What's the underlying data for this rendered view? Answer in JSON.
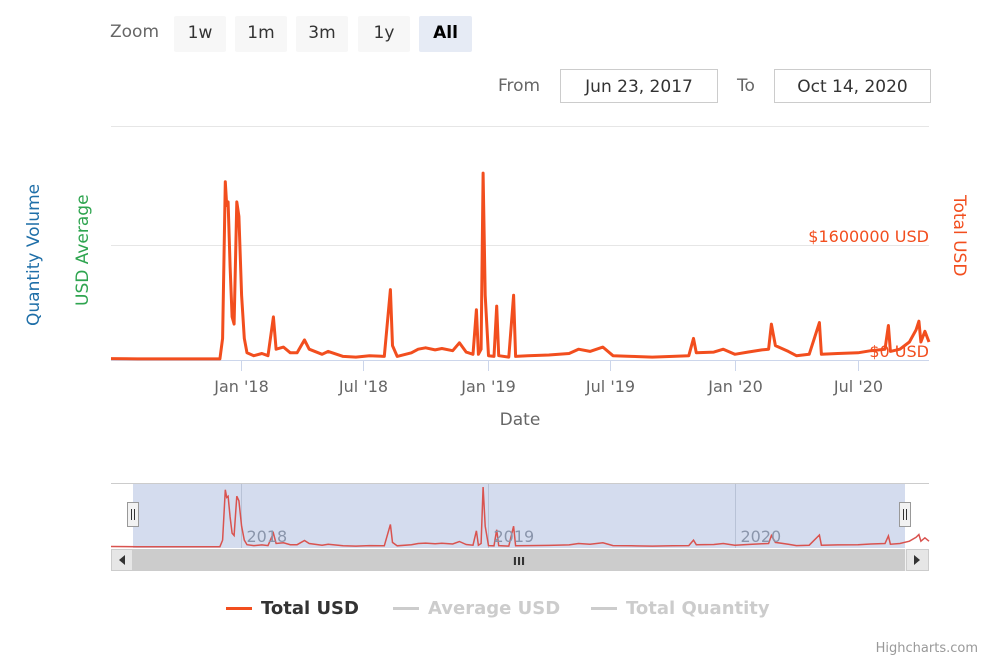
{
  "range_selector": {
    "zoom_label": "Zoom",
    "buttons": [
      {
        "label": "1w",
        "active": false
      },
      {
        "label": "1m",
        "active": false
      },
      {
        "label": "3m",
        "active": false
      },
      {
        "label": "1y",
        "active": false
      },
      {
        "label": "All",
        "active": true
      }
    ],
    "from_label": "From",
    "from_value": "Jun 23, 2017",
    "to_label": "To",
    "to_value": "Oct 14, 2020"
  },
  "colors": {
    "total_usd": "#f24e1e",
    "quantity_axis": "#1f6fa8",
    "average_axis": "#2ea44f",
    "navigator_line": "#d9534f",
    "navigator_mask": "#ccd6eb",
    "legend_hidden": "#cccccc"
  },
  "chart_data": {
    "type": "line",
    "title": "",
    "xlabel": "Date",
    "y_axes": [
      {
        "title": "Quantity Volume",
        "side": "left"
      },
      {
        "title": "USD Average",
        "side": "left"
      },
      {
        "title": "Total USD",
        "side": "right",
        "tick_labels": [
          "$0 USD",
          "$1600000 USD"
        ],
        "ticks": [
          0,
          1600000
        ]
      }
    ],
    "x_range": [
      "2017-06-23",
      "2020-10-14"
    ],
    "ylim": [
      0,
      3000000
    ],
    "x_tick_labels": [
      "Jan '18",
      "Jul '18",
      "Jan '19",
      "Jul '19",
      "Jan '20",
      "Jul '20"
    ],
    "x_ticks": [
      "2018-01-01",
      "2018-07-01",
      "2019-01-01",
      "2019-07-01",
      "2020-01-01",
      "2020-07-01"
    ],
    "grid": true,
    "legend_position": "bottom",
    "series": [
      {
        "name": "Total USD",
        "visible": true,
        "points": [
          [
            "2017-06-23",
            20000
          ],
          [
            "2017-08-01",
            15000
          ],
          [
            "2017-10-01",
            15000
          ],
          [
            "2017-12-01",
            15000
          ],
          [
            "2017-12-05",
            300000
          ],
          [
            "2017-12-09",
            2480000
          ],
          [
            "2017-12-11",
            2150000
          ],
          [
            "2017-12-13",
            2200000
          ],
          [
            "2017-12-16",
            1300000
          ],
          [
            "2017-12-19",
            600000
          ],
          [
            "2017-12-22",
            500000
          ],
          [
            "2017-12-26",
            2200000
          ],
          [
            "2017-12-29",
            2000000
          ],
          [
            "2018-01-02",
            900000
          ],
          [
            "2018-01-06",
            300000
          ],
          [
            "2018-01-10",
            100000
          ],
          [
            "2018-01-20",
            60000
          ],
          [
            "2018-02-01",
            90000
          ],
          [
            "2018-02-10",
            60000
          ],
          [
            "2018-02-18",
            600000
          ],
          [
            "2018-02-22",
            150000
          ],
          [
            "2018-03-05",
            180000
          ],
          [
            "2018-03-15",
            100000
          ],
          [
            "2018-03-25",
            100000
          ],
          [
            "2018-04-05",
            280000
          ],
          [
            "2018-04-12",
            150000
          ],
          [
            "2018-05-01",
            80000
          ],
          [
            "2018-05-10",
            120000
          ],
          [
            "2018-06-01",
            50000
          ],
          [
            "2018-06-20",
            40000
          ],
          [
            "2018-07-10",
            60000
          ],
          [
            "2018-08-01",
            50000
          ],
          [
            "2018-08-10",
            980000
          ],
          [
            "2018-08-13",
            200000
          ],
          [
            "2018-08-20",
            50000
          ],
          [
            "2018-09-10",
            100000
          ],
          [
            "2018-09-20",
            150000
          ],
          [
            "2018-10-01",
            170000
          ],
          [
            "2018-10-15",
            140000
          ],
          [
            "2018-10-25",
            160000
          ],
          [
            "2018-11-10",
            130000
          ],
          [
            "2018-11-20",
            240000
          ],
          [
            "2018-11-30",
            110000
          ],
          [
            "2018-12-10",
            80000
          ],
          [
            "2018-12-15",
            700000
          ],
          [
            "2018-12-18",
            80000
          ],
          [
            "2018-12-22",
            150000
          ],
          [
            "2018-12-25",
            2600000
          ],
          [
            "2018-12-28",
            900000
          ],
          [
            "2019-01-02",
            60000
          ],
          [
            "2019-01-10",
            50000
          ],
          [
            "2019-01-14",
            750000
          ],
          [
            "2019-01-17",
            60000
          ],
          [
            "2019-02-01",
            40000
          ],
          [
            "2019-02-08",
            900000
          ],
          [
            "2019-02-11",
            50000
          ],
          [
            "2019-03-01",
            60000
          ],
          [
            "2019-04-01",
            70000
          ],
          [
            "2019-05-01",
            90000
          ],
          [
            "2019-05-15",
            150000
          ],
          [
            "2019-06-01",
            120000
          ],
          [
            "2019-06-20",
            180000
          ],
          [
            "2019-07-05",
            60000
          ],
          [
            "2019-08-01",
            50000
          ],
          [
            "2019-09-01",
            40000
          ],
          [
            "2019-10-01",
            50000
          ],
          [
            "2019-10-25",
            60000
          ],
          [
            "2019-11-01",
            300000
          ],
          [
            "2019-11-05",
            100000
          ],
          [
            "2019-12-01",
            110000
          ],
          [
            "2019-12-15",
            150000
          ],
          [
            "2020-01-01",
            80000
          ],
          [
            "2020-01-20",
            110000
          ],
          [
            "2020-02-10",
            140000
          ],
          [
            "2020-02-20",
            150000
          ],
          [
            "2020-02-24",
            500000
          ],
          [
            "2020-03-01",
            200000
          ],
          [
            "2020-03-20",
            120000
          ],
          [
            "2020-04-01",
            60000
          ],
          [
            "2020-04-20",
            80000
          ],
          [
            "2020-05-05",
            520000
          ],
          [
            "2020-05-08",
            80000
          ],
          [
            "2020-06-01",
            90000
          ],
          [
            "2020-07-01",
            100000
          ],
          [
            "2020-07-20",
            130000
          ],
          [
            "2020-08-10",
            150000
          ],
          [
            "2020-08-15",
            480000
          ],
          [
            "2020-08-18",
            120000
          ],
          [
            "2020-09-01",
            150000
          ],
          [
            "2020-09-15",
            250000
          ],
          [
            "2020-09-25",
            420000
          ],
          [
            "2020-09-29",
            540000
          ],
          [
            "2020-10-02",
            250000
          ],
          [
            "2020-10-08",
            400000
          ],
          [
            "2020-10-14",
            250000
          ]
        ]
      },
      {
        "name": "Average USD",
        "visible": false,
        "points": []
      },
      {
        "name": "Total Quantity",
        "visible": false,
        "points": []
      }
    ]
  },
  "navigator": {
    "x_labels": [
      "2018",
      "2019",
      "2020"
    ],
    "x_ticks": [
      "2018-01-01",
      "2019-01-01",
      "2020-01-01"
    ],
    "scrollbar_grip": "III"
  },
  "legend": [
    {
      "label": "Total USD",
      "visible": true
    },
    {
      "label": "Average USD",
      "visible": false
    },
    {
      "label": "Total Quantity",
      "visible": false
    }
  ],
  "credits": "Highcharts.com",
  "icons": {
    "scroll_left": "◀",
    "scroll_right": "▶",
    "handle_left": "navigator-handle",
    "handle_right": "navigator-handle"
  }
}
